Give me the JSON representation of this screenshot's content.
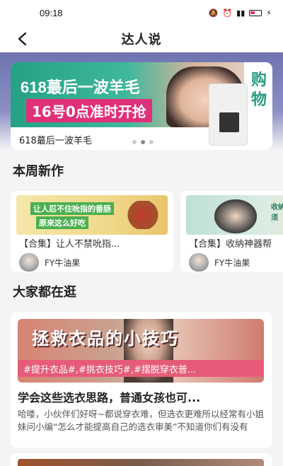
{
  "status_bar": {
    "time": "09:18",
    "icons": [
      "bell-icon",
      "alarm-icon",
      "mute-icon",
      "hd-icon",
      "signal-icon",
      "battery-icon",
      "charging-icon"
    ]
  },
  "nav": {
    "title": "达人说",
    "back_icon": "chevron-left-icon"
  },
  "banner": {
    "headline1": "618蕞后一波羊毛",
    "headline2": "16号0点准时开抢",
    "side_text": "购物",
    "caption": "618蕞后一波羊毛",
    "page_count": 3,
    "active_page": 1
  },
  "new_this_week": {
    "title": "本周新作",
    "cards": [
      {
        "image_text1": "让人忍不住吮指的番肠",
        "image_text2": "原来这么好吃",
        "title": "【合集】让人不禁吮指...",
        "author": "FY牛油果"
      },
      {
        "image_text1": "收纳好物 精致女孩必须",
        "title": "【合集】收纳神器帮",
        "author": "FY牛油果"
      }
    ]
  },
  "browse": {
    "title": "大家都在逛",
    "card": {
      "image_title": "拯救衣品的小技巧",
      "tags": "#提升衣品#,#挑衣技巧#,#摆脱穿衣普...",
      "title": "学会这些选衣思路，普通女孩也可...",
      "description": "哈喽，小伙伴们好呀~都说穿衣难，但选衣更难所以经常有小姐妹问小编“怎么才能提高自己的选衣审美”不知道你们有没有"
    }
  },
  "colors": {
    "header_gradient_top": "#6f73b0",
    "tag_bar": "#e65c78",
    "banner_accent": "#e0307a"
  }
}
